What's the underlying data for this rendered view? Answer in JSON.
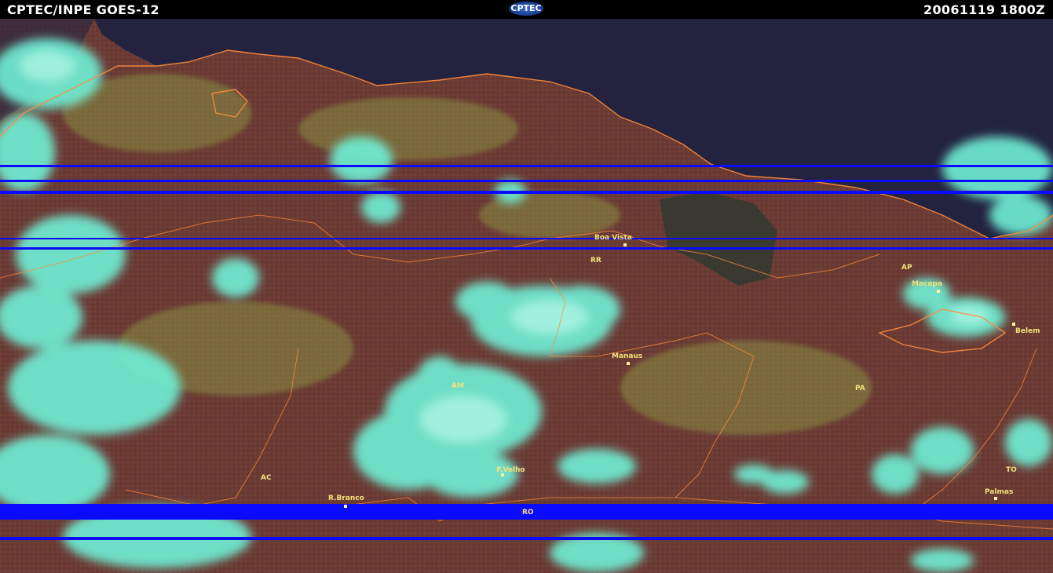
{
  "header": {
    "left_title": "CPTEC/INPE  GOES-12",
    "logo_text": "CPTEC",
    "timestamp": "20061119  1800Z"
  },
  "map": {
    "cities": [
      "Boa Vista",
      "Macapa",
      "Belem",
      "Manaus",
      "P.Velho",
      "R.Branco",
      "Palmas"
    ],
    "states": [
      "RR",
      "AP",
      "AM",
      "PA",
      "AC",
      "RO",
      "TO"
    ]
  },
  "colors": {
    "land": "#6b3a35",
    "ocean": "#23233f",
    "cloud": "#6ff0d6",
    "borders": "#ff8c3a",
    "scan_lines": "#0a0aff",
    "labels": "#f2e27a"
  }
}
